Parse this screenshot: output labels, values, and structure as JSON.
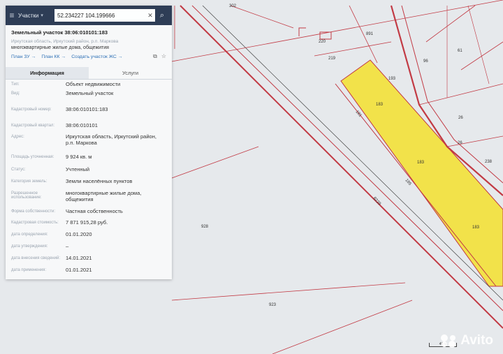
{
  "search": {
    "menu_icon": "menu-icon",
    "layer_label": "Участки",
    "query": "52.234227 104.199666"
  },
  "card": {
    "title": "Земельный участок 38:06:010101:183",
    "address_line": "Иркутская область, Иркутский район, р.п. Маркова",
    "purpose_line": "многоквартирные жилые дома, общежития",
    "links": [
      "План ЗУ →",
      "План КК →",
      "Создать участок ЖС →"
    ]
  },
  "tabs": [
    {
      "label": "Информация",
      "active": true
    },
    {
      "label": "Услуги",
      "active": false
    }
  ],
  "info_rows": [
    {
      "label": "Тип:",
      "value": "Объект недвижимости"
    },
    {
      "label": "Вид:",
      "value": "Земельный участок"
    },
    {
      "label": "Кадастровый номер:",
      "value": "38:06:010101:183"
    },
    {
      "label": "Кадастровый квартал:",
      "value": "38:06:010101"
    },
    {
      "label": "Адрес:",
      "value": "Иркутская область, Иркутский район, р.п. Маркова"
    },
    {
      "label": "Площадь уточненная:",
      "value": "9 924 кв. м"
    },
    {
      "label": "Статус:",
      "value": "Учтенный"
    },
    {
      "label": "Категория земель:",
      "value": "Земли населённых пунктов"
    },
    {
      "label": "Разрешенное использование:",
      "value": "многоквартирные жилые дома, общежития"
    },
    {
      "label": "Форма собственности:",
      "value": "Частная собственность"
    },
    {
      "label": "Кадастровая стоимость:",
      "value": "7 871 915,28 руб."
    },
    {
      "label": "дата определения:",
      "value": "01.01.2020"
    },
    {
      "label": "дата утверждения:",
      "value": "–"
    },
    {
      "label": "дата внесения сведений:",
      "value": "14.01.2021"
    },
    {
      "label": "дата применения:",
      "value": "01.01.2021"
    }
  ],
  "map_labels": {
    "p928": "928",
    "p923": "923",
    "p183a": "183",
    "p183b": "183",
    "p183c": "183",
    "p193": "193",
    "p891": "891",
    "p219": "219",
    "p220": "220",
    "p61": "61",
    "p96": "96",
    "p26a": "26",
    "p26b": "26",
    "p238": "238",
    "p181": "181",
    "p185": "185",
    "p302": "302",
    "road_code": "8229",
    "scale_label": "40 м"
  },
  "watermark": {
    "text": "Avito"
  },
  "colors": {
    "panel_header": "#2e3d56",
    "parcel_highlight": "#f2e24a",
    "boundary": "#c23a44",
    "link": "#2c6fb5"
  }
}
